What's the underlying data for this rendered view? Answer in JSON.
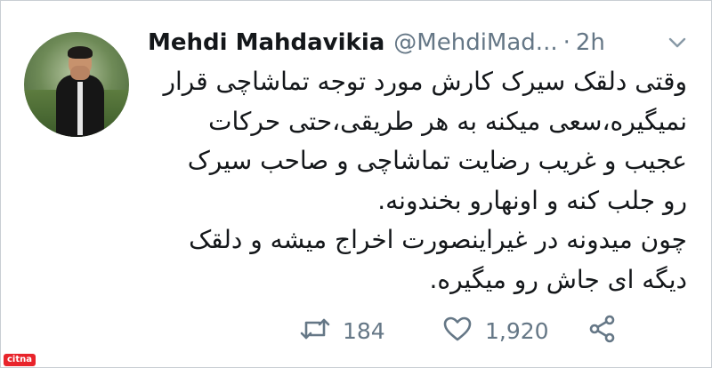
{
  "author": {
    "name": "Mehdi Mahdavikia",
    "handle": "@MehdiMad...",
    "separator": "·",
    "time": "2h"
  },
  "tweet": {
    "lines": [
      "وقتی دلقک سیرک کارش مورد توجه تماشاچی قرار",
      "نمیگیره،سعی میکنه به هر طریقی،حتی حرکات",
      "عجیب و غریب رضایت تماشاچی و صاحب سیرک",
      "رو جلب کنه و اونهارو بخندونه.",
      "چون میدونه در غیراینصورت اخراج میشه و دلقک",
      "دیگه ای جاش رو میگیره."
    ]
  },
  "actions": {
    "retweets": "184",
    "likes": "1,920"
  },
  "icons": {
    "retweet": "retweet-icon",
    "like": "heart-icon",
    "share": "share-icon",
    "menu": "chevron-down-icon"
  },
  "watermark": {
    "text": "citna"
  },
  "colors": {
    "text": "#14171a",
    "muted": "#657786",
    "watermark_bg": "#e8242b"
  }
}
